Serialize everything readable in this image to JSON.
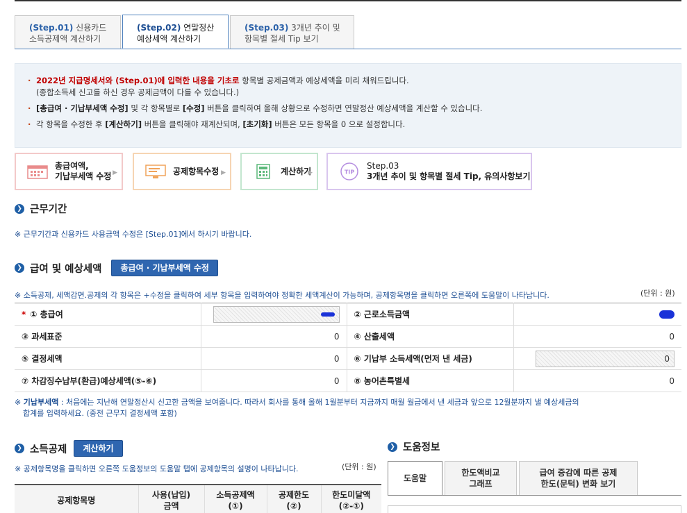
{
  "step_tabs": [
    {
      "step": "(Step.01)",
      "line1_rest": " 신용카드",
      "line2": "소득공제액 계산하기"
    },
    {
      "step": "(Step.02)",
      "line1_rest": " 연말정산",
      "line2": "예상세액 계산하기"
    },
    {
      "step": "(Step.03)",
      "line1_rest": " 3개년 추이 및",
      "line2": "항목별 절세 Tip 보기"
    }
  ],
  "info": {
    "line1_red": "2022년 지급명세서와 (Step.01)에 입력한 내용을 기초로",
    "line1_rest": " 항목별 공제금액과 예상세액을 미리 채워드립니다.",
    "line1_sub": "(종합소득세 신고를 하신 경우 공제금액이 다를 수 있습니다.)",
    "line2_b1": "[총급여 · 기납부세액 수정]",
    "line2_t1": " 및 각 항목별로 ",
    "line2_b2": "[수정]",
    "line2_t2": " 버튼을 클릭하여 올해 상황으로 수정하면 연말정산 예상세액을 계산할 수 있습니다.",
    "line3_t1": "각 항목을 수정한 후 ",
    "line3_b1": "[계산하기]",
    "line3_t2": " 버튼을 클릭해야 재계산되며, ",
    "line3_b2": "[초기화]",
    "line3_t3": " 버튼은 모든 항목을 0 으로 설정합니다."
  },
  "process": {
    "p1_line1": "총급여액,",
    "p1_line2": "기납부세액 수정",
    "p2": "공제항목수정",
    "p3": "계산하기",
    "p4_line1": "Step.03",
    "p4_line2": "3개년 추이 및 항목별 절세 Tip, 유의사항보기",
    "tip_badge": "TIP",
    "arrow": "▶"
  },
  "work_period": {
    "title": "근무기간",
    "note": "※ 근무기간과 신용카드 사용금액 수정은 [Step.01]에서 하시기 바랍니다."
  },
  "salary": {
    "title": "급여 및 예상세액",
    "button": "총급여 · 기납부세액 수정",
    "note": "※ 소득공제, 세액감면.공제의 각 항목은 +수정을 클릭하여 세부 항목을 입력하여야 정확한 세액계산이 가능하며, 공제항목명을 클릭하면 오른쪽에 도움말이 나타납니다.",
    "unit": "(단위 : 원)",
    "required_mark": "*",
    "rows": [
      {
        "l1": "① 총급여",
        "v1": "000",
        "l2": "② 근로소득금액",
        "v2": ""
      },
      {
        "l1": "③ 과세표준",
        "v1": "0",
        "l2": "④ 산출세액",
        "v2": "0"
      },
      {
        "l1": "⑤ 결정세액",
        "v1": "0",
        "l2": "⑥ 기납부 소득세액(먼저 낸 세금)",
        "v2": "0"
      },
      {
        "l1": "⑦ 차감징수납부(환급)예상세액(⑤-⑥)",
        "v1": "0",
        "l2": "⑧ 농어촌특별세",
        "v2": "0"
      }
    ],
    "footnote_prefix": "※ ",
    "footnote_bold": "기납부세액",
    "footnote_line1": " : 처음에는 지난해 연말정산시 신고한 금액을 보여줍니다. 따라서 회사를 통해 올해 1월분부터 지금까지 매월 월급에서 낸 세금과 앞으로 12월분까지 낼 예상세금의",
    "footnote_line2": "합계를 입력하세요. (중전 근무지 결정세액 포함)"
  },
  "deduction": {
    "title": "소득공제",
    "button": "계산하기",
    "note": "※ 공제항목명을 클릭하면 오른쪽 도움정보의 도움말 탭에 공제항목의 설명이 나타납니다.",
    "unit": "(단위 : 원)",
    "columns": [
      {
        "l1": "공제항목명",
        "l2": ""
      },
      {
        "l1": "사용(납입)",
        "l2": "금액"
      },
      {
        "l1": "소득공제액",
        "l2": "(①)"
      },
      {
        "l1": "공제한도",
        "l2": "(②)"
      },
      {
        "l1": "한도미달액",
        "l2": "(②-①)"
      }
    ]
  },
  "help": {
    "title": "도움정보",
    "tabs": [
      {
        "l1": "도움말",
        "l2": ""
      },
      {
        "l1": "한도액비교",
        "l2": "그래프"
      },
      {
        "l1": "급여 증감에 따른 공제",
        "l2": "한도(문턱) 변화 보기"
      }
    ]
  },
  "section_dot": "❯"
}
